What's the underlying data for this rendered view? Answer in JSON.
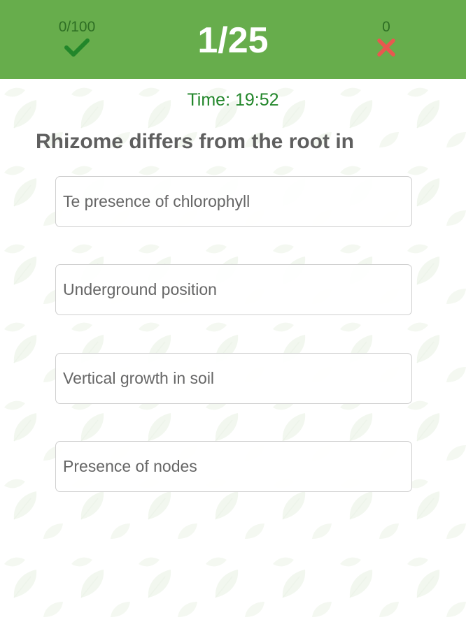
{
  "header": {
    "correct_score": "0/100",
    "question_counter": "1/25",
    "wrong_count": "0",
    "correct_icon": "check-icon",
    "wrong_icon": "cross-icon",
    "background_color": "#67ad4c"
  },
  "timer": {
    "text": "Time: 19:52"
  },
  "question": {
    "text": "Rhizome differs from the root in"
  },
  "options": [
    {
      "label": "Te presence of chlorophyll"
    },
    {
      "label": "Underground position"
    },
    {
      "label": "Vertical growth in soil"
    },
    {
      "label": "Presence of nodes"
    }
  ],
  "colors": {
    "accent_green": "#67ad4c",
    "timer_green": "#22862a",
    "check_green": "#22862a",
    "cross_red": "#e8584f",
    "question_text": "#5f5f5f"
  }
}
